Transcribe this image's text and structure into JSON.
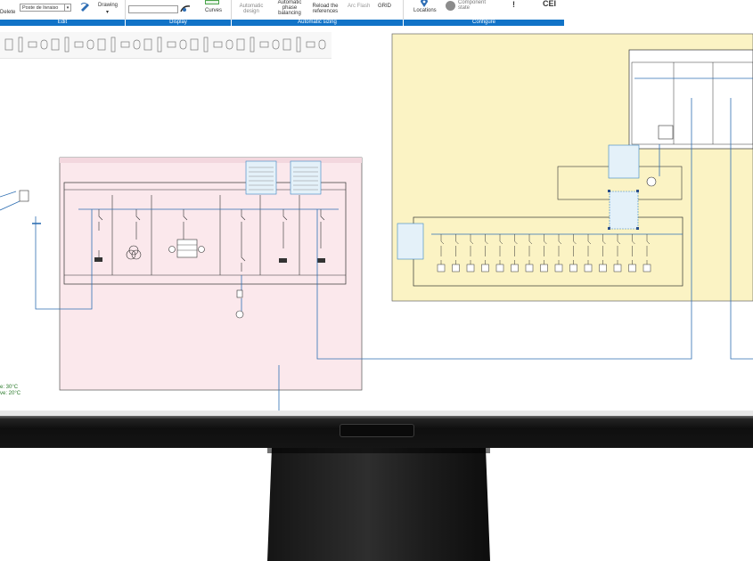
{
  "ribbon": {
    "delete_label": "Delete",
    "site_combo": "Poste de livraiso",
    "drawing_label": "Drawing",
    "curves_label": "Curves",
    "automatic_design_label": "Automatic design",
    "automatic_phase_balancing_label": "Automatic phase balancing",
    "reload_references_label": "Reload the references",
    "arc_flash_label": "Arc Flash",
    "grid_label": "GRID",
    "locations_label": "Locations",
    "component_state_label": "Component state",
    "cei_label": "CEI",
    "groups": {
      "edit": "Edit",
      "display": "Display",
      "automatic_sizing": "Automatic sizing",
      "configure": "Configure"
    }
  },
  "status_notes": {
    "line1": "e: 30°C",
    "line2": "ve: 20°C"
  },
  "colors": {
    "ribbon_accent": "#1173c7",
    "pink_panel": "#fbe8ec",
    "yellow_panel": "#fbf3c4",
    "wire_blue": "#2f6fb3",
    "label_red": "#d23a2a"
  }
}
